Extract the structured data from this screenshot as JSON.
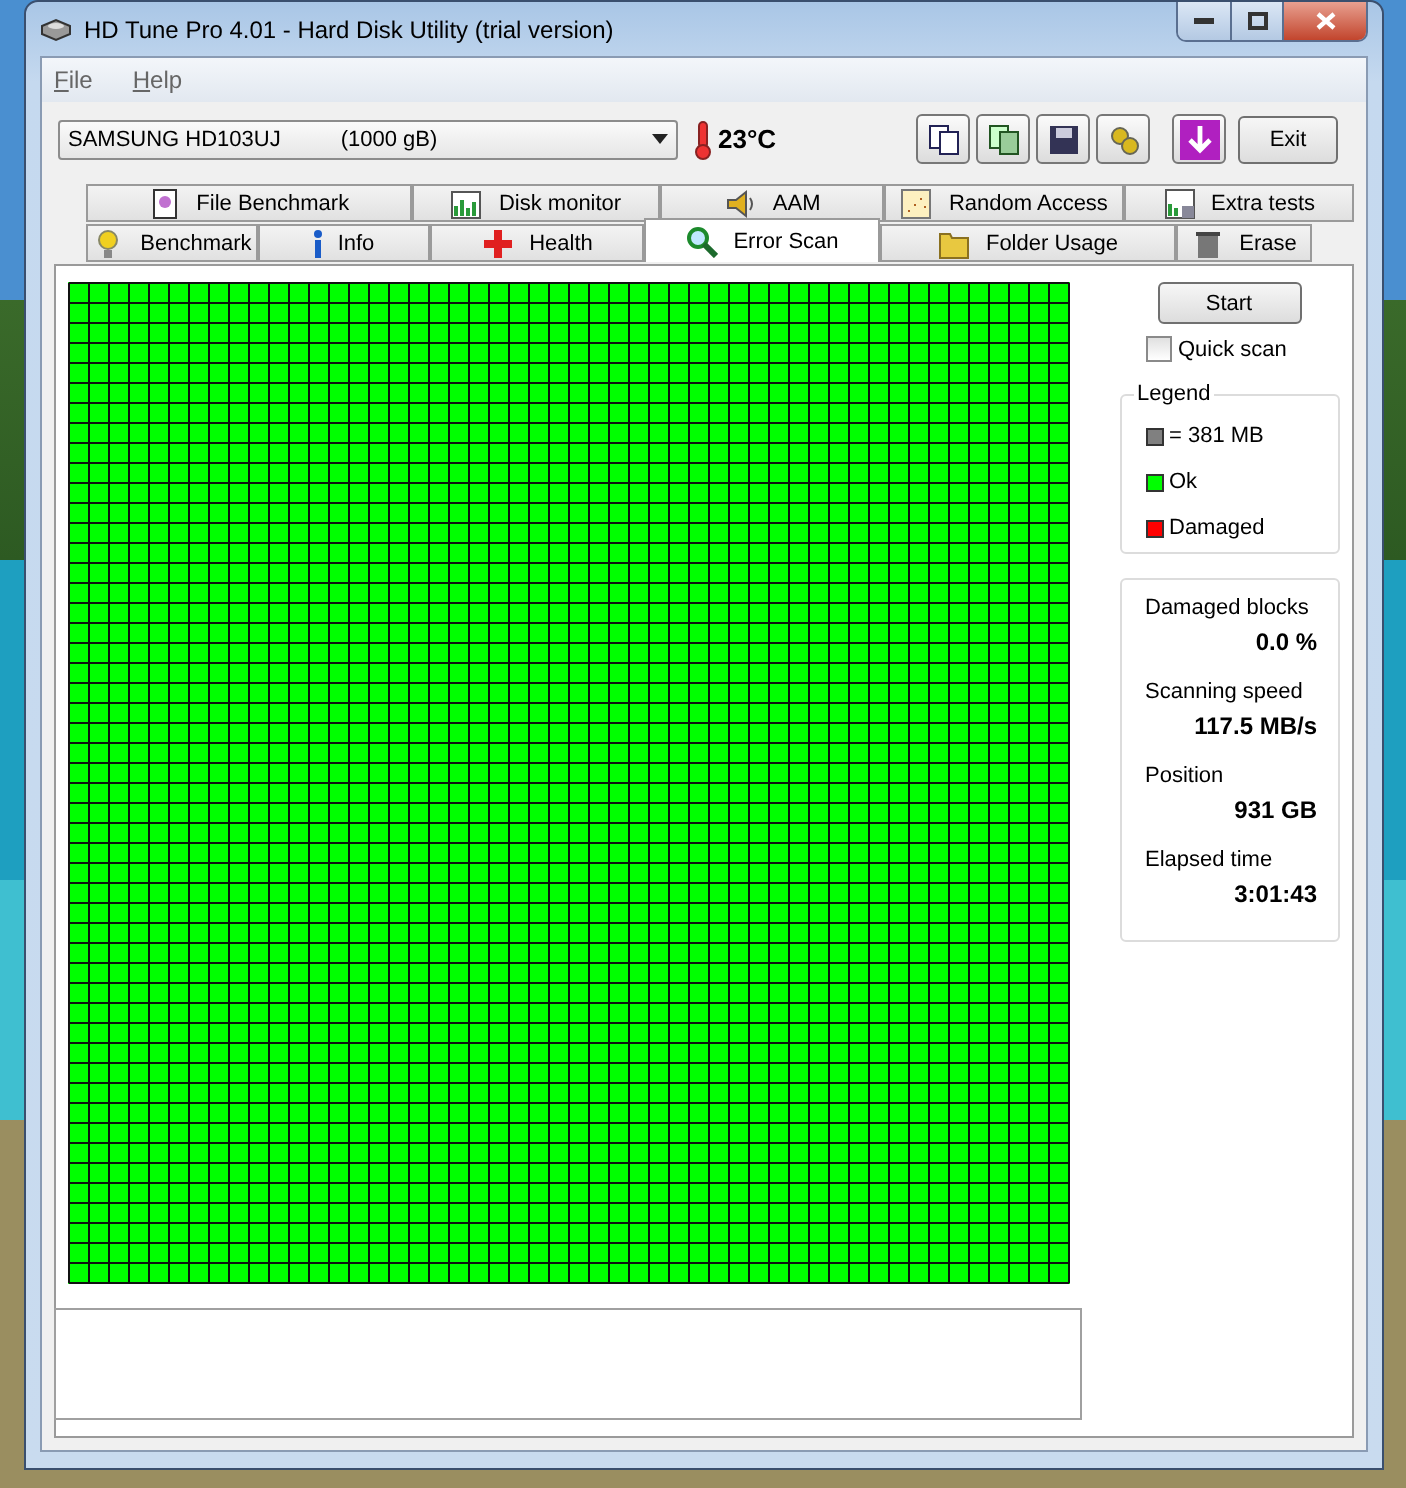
{
  "window": {
    "title": "HD Tune Pro 4.01 - Hard Disk Utility (trial version)"
  },
  "menu": [
    {
      "label": "File"
    },
    {
      "label": "Help"
    }
  ],
  "drive": {
    "name": "SAMSUNG HD103UJ",
    "size": "(1000 gB)"
  },
  "temperature": "23°C",
  "exit_button": "Exit",
  "tab_rows": [
    [
      {
        "label": "File Benchmark",
        "selected": false
      },
      {
        "label": "Disk monitor",
        "selected": false
      },
      {
        "label": "AAM",
        "selected": false
      },
      {
        "label": "Random Access",
        "selected": false
      },
      {
        "label": "Extra tests",
        "selected": false
      }
    ],
    [
      {
        "label": "Benchmark",
        "selected": false
      },
      {
        "label": "Info",
        "selected": false
      },
      {
        "label": "Health",
        "selected": false
      },
      {
        "label": "Error Scan",
        "selected": true
      },
      {
        "label": "Folder Usage",
        "selected": false
      },
      {
        "label": "Erase",
        "selected": false
      }
    ]
  ],
  "start_button": "Start",
  "quick_scan": {
    "label": "Quick scan",
    "checked": false
  },
  "legend": {
    "title": "Legend",
    "items": [
      {
        "label": "= 381 MB",
        "color": "#808080"
      },
      {
        "label": "Ok",
        "color": "#00ff00"
      },
      {
        "label": "Damaged",
        "color": "#ff0000"
      }
    ]
  },
  "stats": [
    {
      "label": "Damaged blocks",
      "value": "0.0 %"
    },
    {
      "label": "Scanning speed",
      "value": "117.5 MB/s"
    },
    {
      "label": "Position",
      "value": "931 GB"
    },
    {
      "label": "Elapsed time",
      "value": "3:01:43"
    }
  ]
}
